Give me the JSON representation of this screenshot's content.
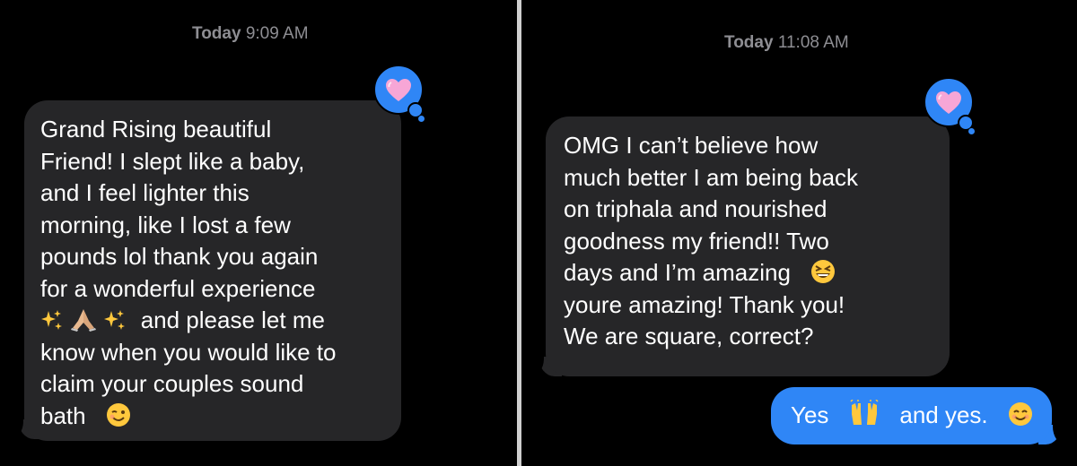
{
  "conversations": [
    {
      "timestamp": {
        "label": "Today",
        "time": "9:09 AM"
      },
      "reaction": "heart-icon",
      "incoming": {
        "lines": [
          "Grand Rising beautiful",
          "Friend! I slept like a baby,",
          "and I feel lighter this",
          "morning, like I lost a few",
          "pounds lol thank you again",
          "for a wonderful experience",
          "and please let me",
          "know when you would like to",
          "claim your couples sound",
          "bath"
        ],
        "emojis": [
          "sparkles-emoji",
          "folded-hands-emoji",
          "sparkles-emoji",
          "winking-face-emoji"
        ]
      }
    },
    {
      "timestamp": {
        "label": "Today",
        "time": "11:08 AM"
      },
      "reaction": "heart-icon",
      "incoming": {
        "lines": [
          "OMG I can’t believe how",
          "much better I am being back",
          "on triphala and nourished",
          "goodness my friend!! Two",
          "days and I’m amazing",
          "youre amazing! Thank you!",
          "We are square, correct?"
        ],
        "emojis": [
          "grinning-squinting-face-emoji"
        ]
      },
      "outgoing": {
        "text_before": "Yes",
        "text_after": "and yes.",
        "emojis": [
          "raising-hands-emoji",
          "smiling-face-emoji"
        ]
      }
    }
  ],
  "colors": {
    "background": "#000000",
    "incoming_bubble": "#262628",
    "outgoing_bubble": "#2f86f6",
    "timestamp_text": "#8e8e93",
    "heart": "#f7a6d6"
  }
}
